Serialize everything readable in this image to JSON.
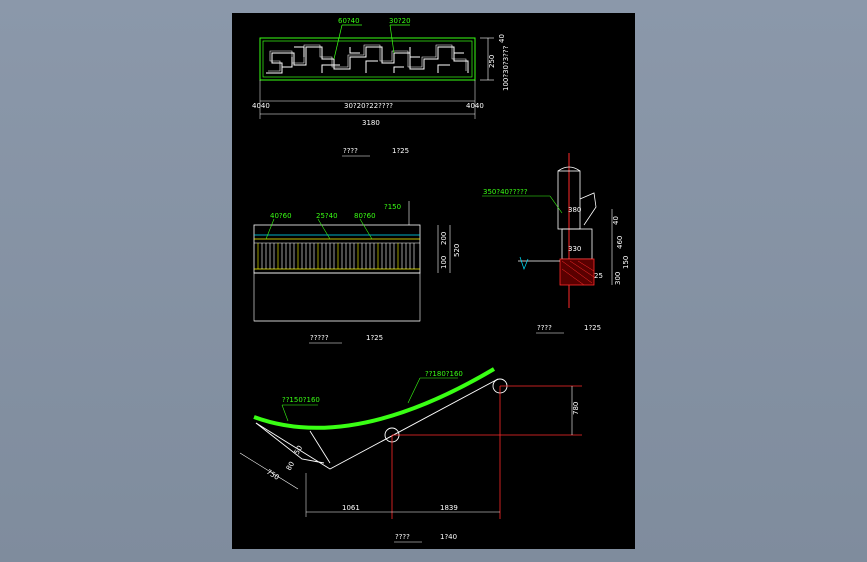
{
  "colors": {
    "background": "#8592a3",
    "sheet": "#000000",
    "line_white": "#ffffff",
    "line_green": "#39ff14",
    "line_yellow": "#ffff00",
    "line_red": "#ff2a2a",
    "line_cyan": "#00e5ff"
  },
  "top_view": {
    "label_a": "60?40",
    "label_b": "30?20",
    "dim_left": "4040",
    "dim_right": "4040",
    "dim_middle": "30?20?22????",
    "dim_total": "3180",
    "dim_side_40": "40",
    "dim_side_250": "250",
    "dim_side_small": "100?30?3???",
    "title": "????",
    "scale": "1?25"
  },
  "mid_view": {
    "label_a": "40?60",
    "label_b": "25?40",
    "label_c": "80?60",
    "label_d": "?150",
    "dim_200": "200",
    "dim_520": "520",
    "dim_100": "100",
    "title": "?????",
    "scale": "1?25"
  },
  "section_view": {
    "label": "350?40?????",
    "dim_380": "380",
    "dim_40": "40",
    "dim_460": "460",
    "dim_330": "330",
    "dim_150": "150",
    "dim_25": "25",
    "dim_300": "300",
    "title": "????",
    "scale": "1?25"
  },
  "bottom_view": {
    "label_a": "??150?160",
    "label_b": "??180?160",
    "dim_750": "750",
    "dim_50": "50",
    "dim_80": "80",
    "dim_780": "780",
    "dim_1061": "1061",
    "dim_1839": "1839",
    "title": "????",
    "scale": "1?40"
  }
}
